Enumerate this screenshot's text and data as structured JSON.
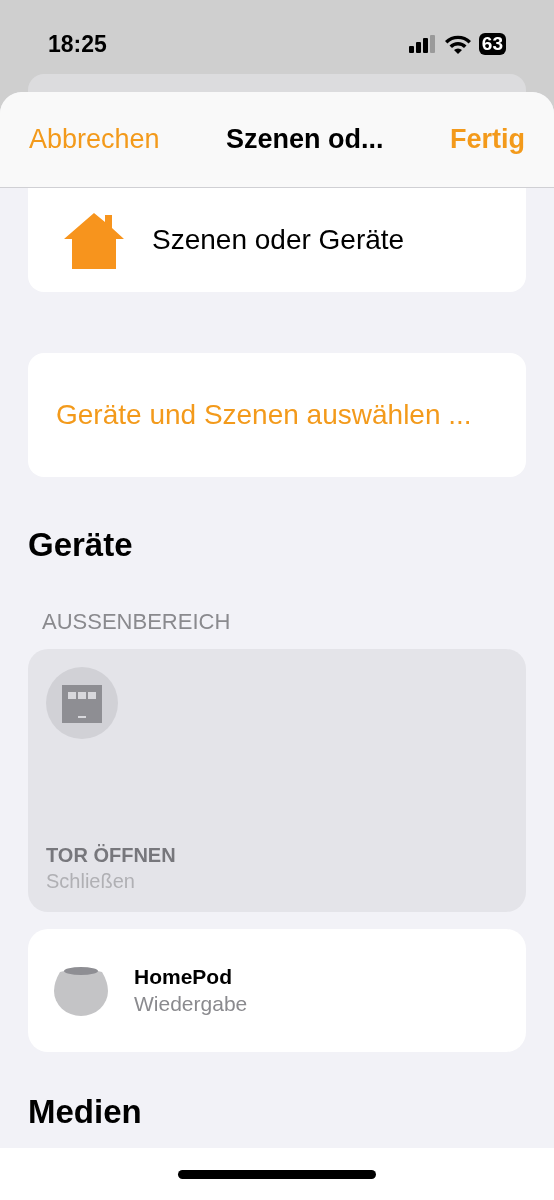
{
  "status_bar": {
    "time": "18:25",
    "battery": "63"
  },
  "nav": {
    "cancel": "Abbrechen",
    "title": "Szenen od...",
    "done": "Fertig"
  },
  "header_card": {
    "label": "Szenen oder Geräte"
  },
  "select_button": {
    "label": "Geräte und Szenen auswählen ..."
  },
  "devices_section": {
    "title": "Geräte",
    "room": "AUSSENBEREICH",
    "items": [
      {
        "kind": "tile",
        "name": "TOR ÖFFNEN",
        "status": "Schließen",
        "on": false
      },
      {
        "kind": "row",
        "name": "HomePod",
        "status": "Wiedergabe"
      }
    ]
  },
  "media_section": {
    "title": "Medien"
  }
}
